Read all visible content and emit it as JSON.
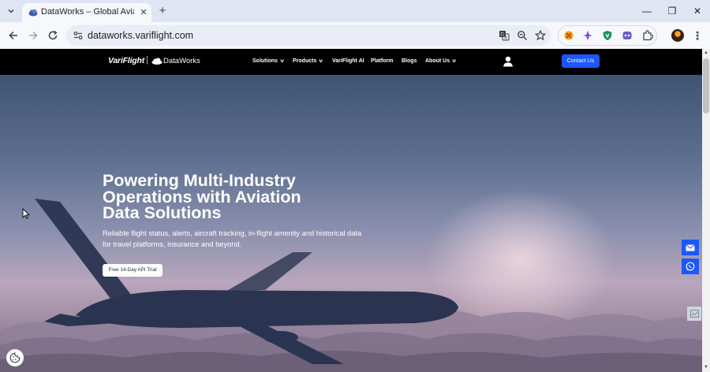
{
  "browser": {
    "tab_title": "DataWorks – Global Aviation",
    "tab_close": "✕",
    "new_tab": "+",
    "url": "dataworks.variflight.com",
    "window_controls": {
      "minimize": "—",
      "restore": "❐",
      "close": "✕"
    },
    "icons": [
      "tab-search-icon",
      "back-icon",
      "forward-icon",
      "reload-icon",
      "site-info-icon",
      "translate-icon",
      "zoom-icon",
      "bookmark-star-icon",
      "extension-icon",
      "profile-avatar",
      "more-menu-icon"
    ]
  },
  "site": {
    "logo": {
      "brand": "VariFlight",
      "separator": "|",
      "product": "DataWorks"
    },
    "menu": [
      {
        "label": "Solutions",
        "has_dropdown": true
      },
      {
        "label": "Products",
        "has_dropdown": true
      },
      {
        "label": "VariFlight AI",
        "has_dropdown": false
      },
      {
        "label": "Platform",
        "has_dropdown": false
      },
      {
        "label": "Blogs",
        "has_dropdown": false
      },
      {
        "label": "About Us",
        "has_dropdown": true
      }
    ],
    "contact_label": "Contact Us",
    "accent_color": "#1d57ff"
  },
  "hero": {
    "title_lines": [
      "Powering Multi-Industry",
      "Operations with Aviation",
      "Data Solutions"
    ],
    "subtitle_lines": [
      "Reliable flight status, alerts, aircraft tracking, in-flight amenity and historical data",
      "for travel platforms, insurance and beyond."
    ],
    "cta_label": "Free 14-Day API Trial"
  }
}
